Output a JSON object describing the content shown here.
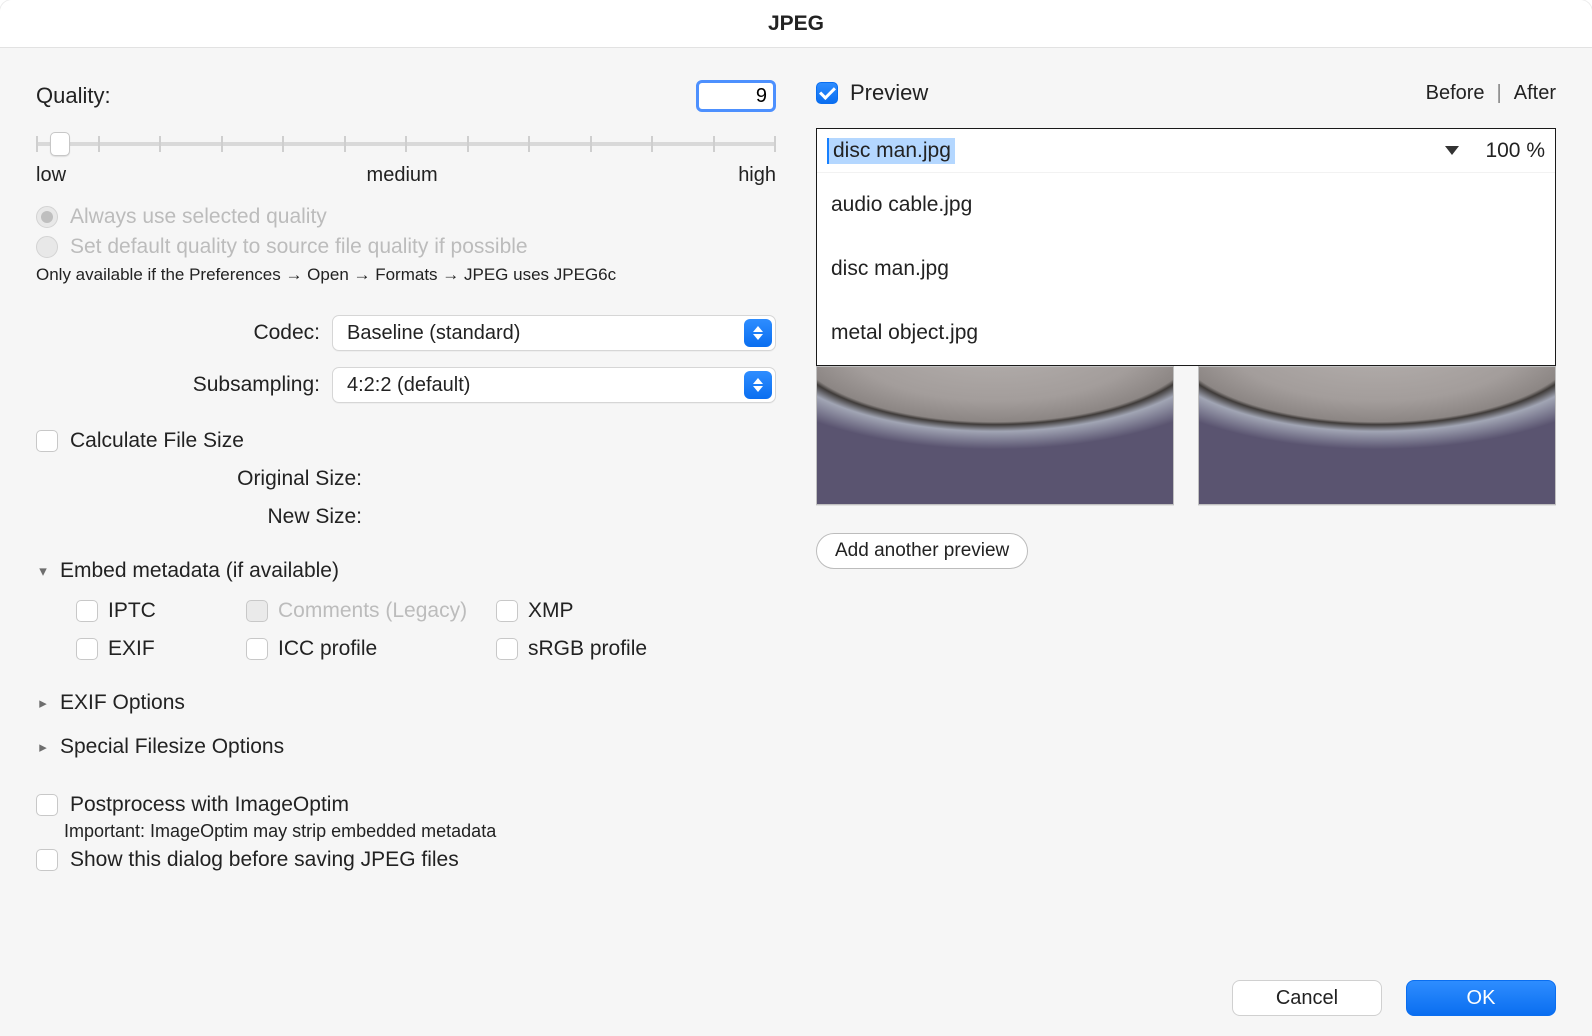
{
  "title": "JPEG",
  "left": {
    "quality_label": "Quality:",
    "quality_value": "9",
    "slider": {
      "low": "low",
      "medium": "medium",
      "high": "high"
    },
    "radio_selected_label": "Always use selected quality",
    "radio_source_label": "Set default quality to source file quality if possible",
    "radio_hint": "Only available if the Preferences → Open → Formats → JPEG uses JPEG6c",
    "codec_label": "Codec:",
    "codec_value": "Baseline (standard)",
    "subsampling_label": "Subsampling:",
    "subsampling_value": "4:2:2 (default)",
    "calc_label": "Calculate File Size",
    "original_size_label": "Original Size:",
    "new_size_label": "New Size:",
    "embed_label": "Embed metadata (if available)",
    "meta": {
      "iptc": "IPTC",
      "comments": "Comments (Legacy)",
      "xmp": "XMP",
      "exif": "EXIF",
      "icc": "ICC profile",
      "srgb": "sRGB profile"
    },
    "exif_options": "EXIF Options",
    "special_options": "Special Filesize Options",
    "postprocess": "Postprocess with ImageOptim",
    "postprocess_note": "Important: ImageOptim may strip embedded metadata",
    "show_dialog": "Show this dialog before saving JPEG files"
  },
  "right": {
    "preview_label": "Preview",
    "before": "Before",
    "after": "After",
    "selected_file": "disc man.jpg",
    "zoom": "100 %",
    "options": [
      "audio cable.jpg",
      "disc man.jpg",
      "metal object.jpg"
    ],
    "add_preview": "Add another preview"
  },
  "footer": {
    "cancel": "Cancel",
    "ok": "OK"
  }
}
